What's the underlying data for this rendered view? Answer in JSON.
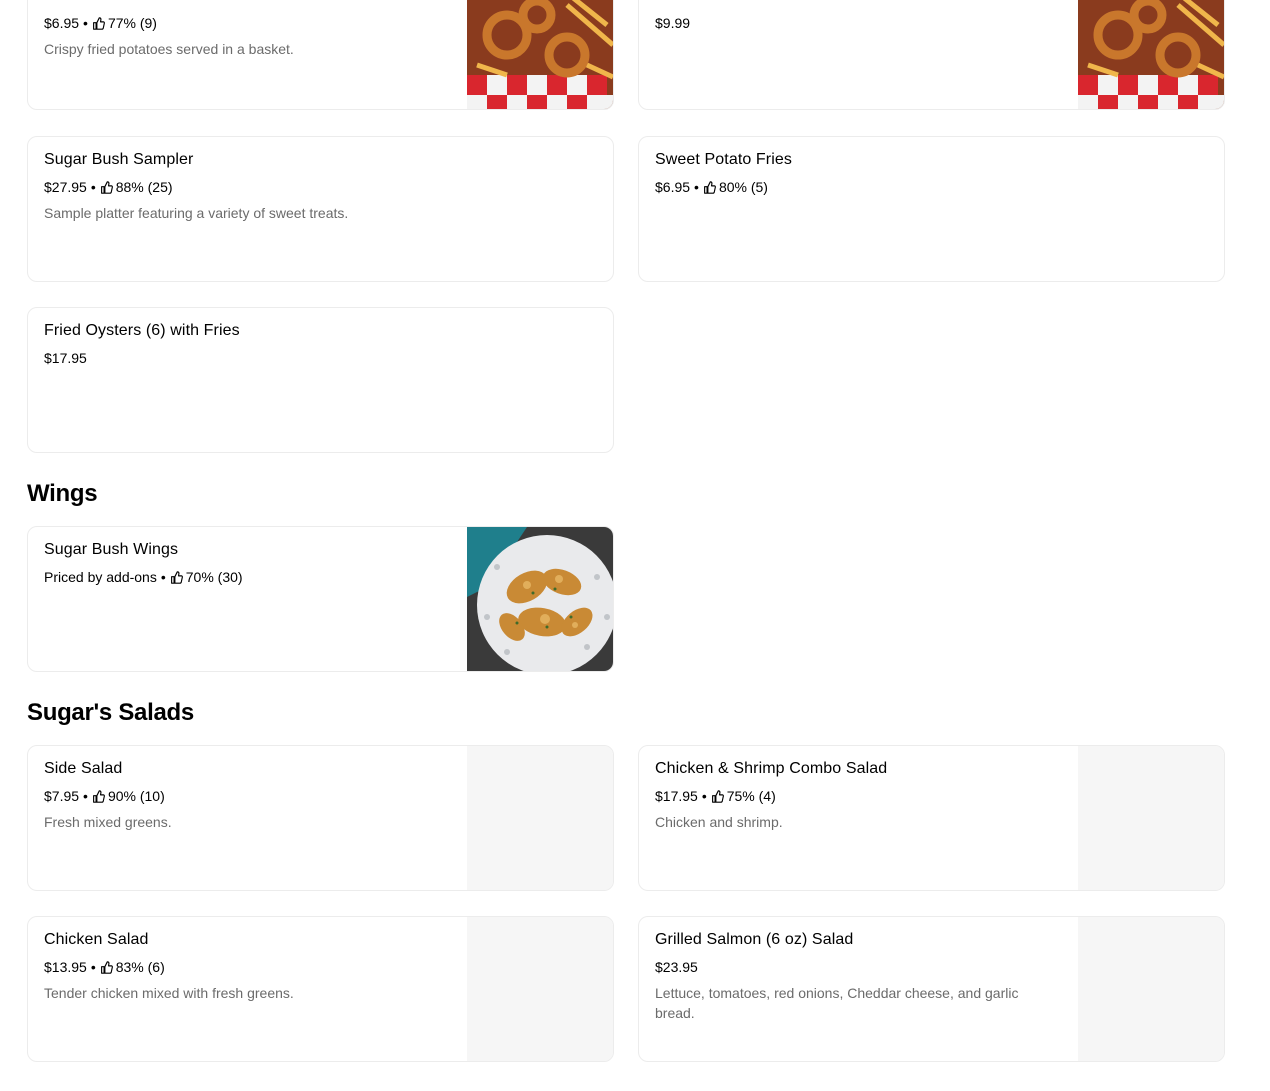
{
  "items_top": [
    {
      "price": "$6.95",
      "rating": "77% (9)",
      "desc": "Crispy fried potatoes served in a basket."
    },
    {
      "price": "$9.99"
    }
  ],
  "items_row2": [
    {
      "name": "Sugar Bush Sampler",
      "price": "$27.95",
      "rating": "88% (25)",
      "desc": "Sample platter featuring a variety of sweet treats."
    },
    {
      "name": "Sweet Potato Fries",
      "price": "$6.95",
      "rating": "80% (5)"
    }
  ],
  "items_row3": [
    {
      "name": "Fried Oysters (6) with Fries",
      "price": "$17.95"
    }
  ],
  "wings": {
    "title": "Wings",
    "items": [
      {
        "name": "Sugar Bush Wings",
        "price": "Priced by add-ons",
        "rating": "70% (30)"
      }
    ]
  },
  "salads": {
    "title": "Sugar's Salads",
    "items": [
      {
        "name": "Side Salad",
        "price": "$7.95",
        "rating": "90% (10)",
        "desc": "Fresh mixed greens."
      },
      {
        "name": "Chicken & Shrimp Combo Salad",
        "price": "$17.95",
        "rating": "75% (4)",
        "desc": "Chicken and shrimp."
      },
      {
        "name": "Chicken Salad",
        "price": "$13.95",
        "rating": "83% (6)",
        "desc": "Tender chicken mixed with fresh greens."
      },
      {
        "name": "Grilled Salmon (6 oz) Salad",
        "price": "$23.95",
        "desc": "Lettuce, tomatoes, red onions, Cheddar cheese, and garlic bread."
      }
    ]
  },
  "icons": {
    "rating": "thumbs-up-icon"
  },
  "colors": {
    "text": "#000000",
    "muted": "#6b6b6b",
    "border": "#ececec",
    "placeholder": "#f6f6f6"
  }
}
